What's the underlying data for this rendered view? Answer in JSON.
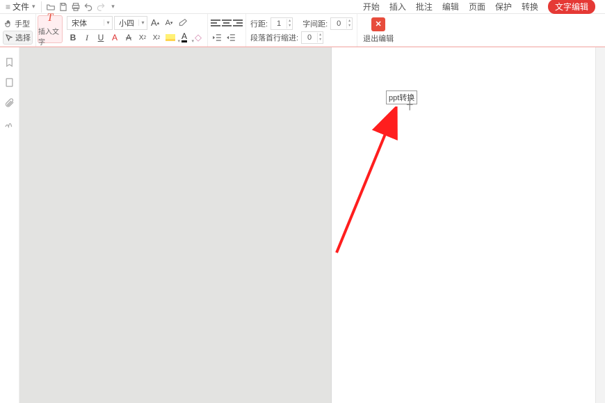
{
  "menu": {
    "file": "文件"
  },
  "tabs": {
    "start": "开始",
    "insert": "插入",
    "comment": "批注",
    "edit": "编辑",
    "page": "页面",
    "protect": "保护",
    "convert": "转换",
    "text_edit": "文字编辑"
  },
  "tools": {
    "hand": "手型",
    "select": "选择",
    "insert_text": "插入文字"
  },
  "font": {
    "family": "宋体",
    "size_label": "小四"
  },
  "paragraph": {
    "line_spacing_label": "行距:",
    "line_spacing_value": "1",
    "char_spacing_label": "字间距:",
    "char_spacing_value": "0",
    "first_line_indent_label": "段落首行缩进:",
    "first_line_indent_value": "0"
  },
  "exit": {
    "label": "退出编辑"
  },
  "page_content": {
    "textbox": "ppt转换"
  }
}
